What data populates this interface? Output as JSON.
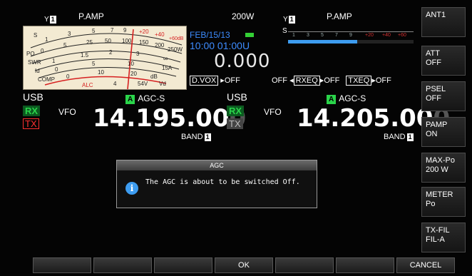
{
  "status_left": {
    "ant": "1",
    "pamp": "P.AMP",
    "power": "200W"
  },
  "status_right": {
    "ant": "1",
    "pamp": "P.AMP"
  },
  "meter": {
    "scales": [
      "S",
      "PO",
      "SWR",
      "Id",
      "COMP",
      "ALC"
    ],
    "ticks_s": [
      "1",
      "3",
      "5",
      "7",
      "9",
      "+20",
      "+40",
      "+60dB"
    ],
    "ticks_po": [
      "0",
      "5",
      "25",
      "50",
      "100",
      "150",
      "200",
      "250W"
    ],
    "ticks_swr": [
      "1",
      "1.5",
      "2",
      "3",
      "∞"
    ],
    "ticks_id": [
      "0",
      "5",
      "10",
      "15A"
    ],
    "ticks_comp": [
      "0",
      "10",
      "20",
      "dB"
    ],
    "ticks_vd": [
      "4",
      "54V",
      "Vd"
    ]
  },
  "info": {
    "date": "FEB/15/13",
    "time": "10:00 01:00U",
    "value": "0.000",
    "dvox_label": "D.VOX",
    "dvox_value": "OFF",
    "off_left": "OFF",
    "rxeq_label": "RXEQ",
    "rxeq_value": "OFF",
    "txeq_label": "TXEQ",
    "txeq_value": "OFF"
  },
  "bar_meter": {
    "label": "S",
    "ticks": [
      "1",
      "3",
      "5",
      "7",
      "9",
      "+20",
      "+40",
      "+60"
    ],
    "level": 0.55
  },
  "vfo_main": {
    "mode": "USB",
    "rx": "RX",
    "tx": "TX",
    "vfo": "VFO",
    "agc_badge": "A",
    "agc": "AGC-S",
    "freq_bright": "14.195.00",
    "freq_dim": "0",
    "band_label": "BAND",
    "band_num": "1"
  },
  "vfo_sub": {
    "mode": "USB",
    "rx": "RX",
    "tx": "TX",
    "vfo": "VFO",
    "agc_badge": "A",
    "agc": "AGC-S",
    "freq_bright": "14.205.00",
    "freq_dim": "0",
    "band_label": "BAND",
    "band_num": "1"
  },
  "right_buttons": [
    {
      "l1": "ANT1",
      "l2": ""
    },
    {
      "l1": "ATT",
      "l2": "OFF"
    },
    {
      "l1": "PSEL",
      "l2": "OFF"
    },
    {
      "l1": "PAMP",
      "l2": "ON"
    },
    {
      "l1": "MAX-Po",
      "l2": "200 W"
    },
    {
      "l1": "METER",
      "l2": "Po"
    },
    {
      "l1": "TX-FIL",
      "l2": "FIL-A"
    }
  ],
  "bottom_buttons": [
    "",
    "",
    "",
    "OK",
    "",
    "",
    "CANCEL"
  ],
  "dialog": {
    "title": "AGC",
    "message": "The AGC is about to be switched Off."
  },
  "colors": {
    "accent_blue": "#3d8cff",
    "rx_green": "#2ad44a",
    "tx_red": "#ff3030"
  }
}
